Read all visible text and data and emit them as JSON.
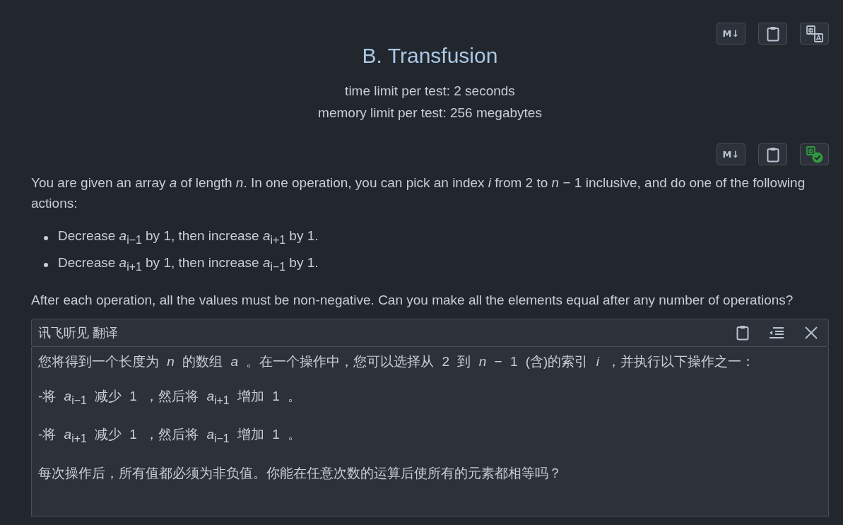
{
  "header_toolbar": {
    "markdown_label": "M↓",
    "translated": false
  },
  "title": "B. Transfusion",
  "limits": [
    "time limit per test: 2 seconds",
    "memory limit per test: 256 megabytes"
  ],
  "statement_toolbar": {
    "markdown_label": "M↓",
    "translated": true
  },
  "statement": [
    {
      "kind": "paragraph",
      "text": "You are given an array *a* of length *n*. In one operation, you can pick an index *i* from 2 to *n* − 1 inclusive, and do one of the following actions:"
    },
    {
      "kind": "list",
      "items": [
        "Decrease *a*$_{i−1}$ by 1, then increase *a*$_{i+1}$ by 1.",
        "Decrease *a*$_{i+1}$ by 1, then increase *a*$_{i−1}$ by 1."
      ]
    },
    {
      "kind": "paragraph",
      "text": "After each operation, all the values must be non-negative. Can you make all the elements equal after any number of operations?"
    }
  ],
  "translation": {
    "title": "讯飞听见 翻译",
    "paragraphs": [
      "您将得到一个长度为 *n* 的数组 *a* 。在一个操作中，您可以选择从 2 到 *n* − 1 (含)的索引 *i* ，并执行以下操作之一：",
      "-将 *a*$_{i−1}$ 减少 1 ，然后将 *a*$_{i+1}$ 增加 1 。",
      "-将 *a*$_{i+1}$ 减少 1 ，然后将 *a*$_{i−1}$ 增加 1 。",
      "每次操作后，所有值都必须为非负值。你能在任意次数的运算后使所有的元素都相等吗？"
    ]
  }
}
